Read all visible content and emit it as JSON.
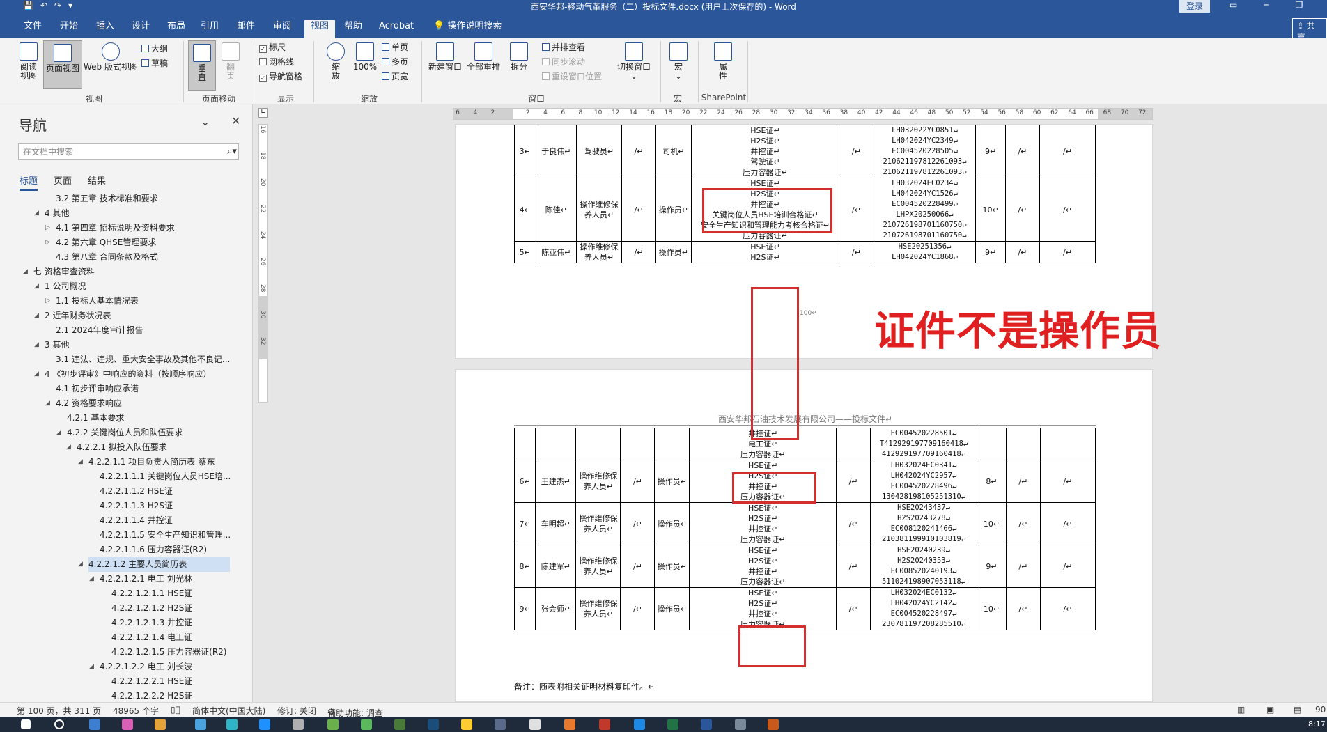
{
  "window": {
    "title": "西安华邦-移动气革服务（二）投标文件.docx (用户上次保存的) - Word",
    "login": "登录",
    "controls": [
      "▭",
      "─",
      "❐",
      "✕"
    ]
  },
  "tabs": [
    "文件",
    "开始",
    "插入",
    "设计",
    "布局",
    "引用",
    "邮件",
    "审阅",
    "视图",
    "帮助",
    "Acrobat",
    "操作说明搜索"
  ],
  "share": "共享",
  "ribbon": {
    "views": {
      "read": "阅读\n视图",
      "print": "页面视图",
      "web": "Web 版式视图",
      "outline": "大纲",
      "draft": "草稿",
      "label": "视图"
    },
    "page_move": {
      "vertical": "垂\n直",
      "side": "翻\n页",
      "label": "页面移动"
    },
    "show": {
      "ruler": "标尺",
      "grid": "网格线",
      "nav": "导航窗格",
      "label": "显示"
    },
    "zoom": {
      "zoom": "缩\n放",
      "hundred": "100%",
      "single": "单页",
      "multi": "多页",
      "width": "页宽",
      "label": "缩放"
    },
    "window": {
      "new": "新建窗口",
      "arrange": "全部重排",
      "split": "拆分",
      "side": "并排查看",
      "sync": "同步滚动",
      "reset": "重设窗口位置",
      "switch": "切换窗口",
      "label": "窗口"
    },
    "macro": {
      "btn": "宏",
      "label": "宏"
    },
    "sharepoint": {
      "btn": "属\n性",
      "label": "SharePoint"
    }
  },
  "nav": {
    "title": "导航",
    "search_placeholder": "在文档中搜索",
    "tabs": [
      "标题",
      "页面",
      "结果"
    ],
    "tree": [
      {
        "t": "3.2 第五章  技术标准和要求",
        "lvl": 2
      },
      {
        "t": "4 其他",
        "lvl": 1,
        "ar": "◢"
      },
      {
        "t": "4.1 第四章  招标说明及资料要求",
        "lvl": 2,
        "ar": "▷"
      },
      {
        "t": "4.2 第六章  QHSE管理要求",
        "lvl": 2,
        "ar": "▷"
      },
      {
        "t": "4.3 第八章  合同条款及格式",
        "lvl": 2
      },
      {
        "t": "七  资格审查资料",
        "lvl": 0,
        "ar": "◢"
      },
      {
        "t": "1 公司概况",
        "lvl": 1,
        "ar": "◢"
      },
      {
        "t": "1.1 投标人基本情况表",
        "lvl": 2,
        "ar": "▷"
      },
      {
        "t": "2 近年财务状况表",
        "lvl": 1,
        "ar": "◢"
      },
      {
        "t": "2.1 2024年度审计报告",
        "lvl": 2
      },
      {
        "t": "3 其他",
        "lvl": 1,
        "ar": "◢"
      },
      {
        "t": "3.1 违法、违规、重大安全事故及其他不良记...",
        "lvl": 2
      },
      {
        "t": "4 《初步评审》中响应的资料（按顺序响应）",
        "lvl": 1,
        "ar": "◢"
      },
      {
        "t": "4.1 初步评审响应承诺",
        "lvl": 2
      },
      {
        "t": "4.2 资格要求响应",
        "lvl": 2,
        "ar": "◢"
      },
      {
        "t": "4.2.1 基本要求",
        "lvl": 3
      },
      {
        "t": "4.2.2 关键岗位人员和队伍要求",
        "lvl": 3,
        "ar": "◢"
      },
      {
        "t": "4.2.2.1 拟投入队伍要求",
        "lvl": 4,
        "ar": "◢"
      },
      {
        "t": "4.2.2.1.1 项目负责人简历表-蔡东",
        "lvl": 5,
        "ar": "◢"
      },
      {
        "t": "4.2.2.1.1.1 关键岗位人员HSE培...",
        "lvl": 6
      },
      {
        "t": "4.2.2.1.1.2 HSE证",
        "lvl": 6
      },
      {
        "t": "4.2.2.1.1.3 H2S证",
        "lvl": 6
      },
      {
        "t": "4.2.2.1.1.4 井控证",
        "lvl": 6
      },
      {
        "t": "4.2.2.1.1.5 安全生产知识和管理...",
        "lvl": 6
      },
      {
        "t": "4.2.2.1.1.6 压力容器证(R2)",
        "lvl": 6
      },
      {
        "t": "4.2.2.1.2 主要人员简历表",
        "lvl": 5,
        "ar": "◢",
        "sel": true
      },
      {
        "t": "4.2.2.1.2.1 电工-刘光林",
        "lvl": 6,
        "ar": "◢"
      },
      {
        "t": "4.2.2.1.2.1.1 HSE证",
        "lvl": 7
      },
      {
        "t": "4.2.2.1.2.1.2 H2S证",
        "lvl": 7
      },
      {
        "t": "4.2.2.1.2.1.3 井控证",
        "lvl": 7
      },
      {
        "t": "4.2.2.1.2.1.4 电工证",
        "lvl": 7
      },
      {
        "t": "4.2.2.1.2.1.5 压力容器证(R2)",
        "lvl": 7
      },
      {
        "t": "4.2.2.1.2.2 电工-刘长波",
        "lvl": 6,
        "ar": "◢"
      },
      {
        "t": "4.2.2.1.2.2.1 HSE证",
        "lvl": 7
      },
      {
        "t": "4.2.2.1.2.2.2 H2S证",
        "lvl": 7
      }
    ]
  },
  "page1": {
    "rows": [
      {
        "no": "3↵",
        "name": "于良伟↵",
        "role": "驾驶员↵",
        "c4": "/↵",
        "post": "司机↵",
        "certs": [
          "HSE证↵",
          "H2S证↵",
          "井控证↵",
          "驾驶证↵",
          "压力容器证↵"
        ],
        "c7": "/↵",
        "nums": [
          "LH032022YC0851↵",
          "LH042024YC2349↵",
          "EC004520228505↵",
          "210621197812261093↵",
          "210621197812261093↵"
        ],
        "yrs": "9↵",
        "c10": "/↵",
        "c11": "/↵"
      },
      {
        "no": "4↵",
        "name": "陈佳↵",
        "role": "操作维修保养人员↵",
        "c4": "/↵",
        "post": "操作员↵",
        "certs": [
          "HSE证↵",
          "H2S证↵",
          "井控证↵",
          "关键岗位人员HSE培训合格证↵",
          "安全生产知识和管理能力考核合格证↵",
          "压力容器证↵"
        ],
        "c7": "/↵",
        "nums": [
          "LH032024EC0234↵",
          "LH042024YC1526↵",
          "EC004520228499↵",
          "LHPX20250066↵",
          "210726198701160750↵",
          "210726198701160750↵"
        ],
        "yrs": "10↵",
        "c10": "/↵",
        "c11": "/↵"
      },
      {
        "no": "5↵",
        "name": "陈亚伟↵",
        "role": "操作维修保养人员↵",
        "c4": "/↵",
        "post": "操作员↵",
        "certs": [
          "HSE证↵",
          "H2S证↵"
        ],
        "c7": "/↵",
        "nums": [
          "HSE20251356↵",
          "LH042024YC1868↵"
        ],
        "yrs": "9↵",
        "c10": "/↵",
        "c11": "/↵"
      }
    ],
    "page_num": "100↵"
  },
  "annotation": "证件不是操作员",
  "page2": {
    "header": "西安华邦石油技术发展有限公司——投标文件↵",
    "cont": {
      "certs": [
        "井控证↵",
        "电工证↵",
        "压力容器证↵"
      ],
      "nums": [
        "EC004520228501↵",
        "T412929197709160418↵",
        "412929197709160418↵"
      ]
    },
    "rows": [
      {
        "no": "6↵",
        "name": "王建杰↵",
        "role": "操作维修保养人员↵",
        "c4": "/↵",
        "post": "操作员↵",
        "certs": [
          "HSE证↵",
          "H2S证↵",
          "井控证↵",
          "压力容器证↵"
        ],
        "c7": "/↵",
        "nums": [
          "LH032024EC0341↵",
          "LH042024YC2957↵",
          "EC004520228496↵",
          "130428198105251310↵"
        ],
        "yrs": "8↵",
        "c10": "/↵",
        "c11": "/↵"
      },
      {
        "no": "7↵",
        "name": "车明超↵",
        "role": "操作维修保养人员↵",
        "c4": "/↵",
        "post": "操作员↵",
        "certs": [
          "HSE证↵",
          "H2S证↵",
          "井控证↵",
          "压力容器证↵"
        ],
        "c7": "/↵",
        "nums": [
          "HSE20243437↵",
          "H2S20243278↵",
          "EC008120241466↵",
          "210381199910103819↵"
        ],
        "yrs": "10↵",
        "c10": "/↵",
        "c11": "/↵"
      },
      {
        "no": "8↵",
        "name": "陈建军↵",
        "role": "操作维修保养人员↵",
        "c4": "/↵",
        "post": "操作员↵",
        "certs": [
          "HSE证↵",
          "H2S证↵",
          "井控证↵",
          "压力容器证↵"
        ],
        "c7": "/↵",
        "nums": [
          "HSE20240239↵",
          "H2S20240353↵",
          "EC008520240193↵",
          "511024198907053118↵"
        ],
        "yrs": "9↵",
        "c10": "/↵",
        "c11": "/↵"
      },
      {
        "no": "9↵",
        "name": "张会师↵",
        "role": "操作维修保养人员↵",
        "c4": "/↵",
        "post": "操作员↵",
        "certs": [
          "HSE证↵",
          "H2S证↵",
          "井控证↵",
          "压力容器证↵"
        ],
        "c7": "/↵",
        "nums": [
          "LH032024EC0132↵",
          "LH042024YC2142↵",
          "EC004520228497↵",
          "230781197208285510↵"
        ],
        "yrs": "10↵",
        "c10": "/↵",
        "c11": "/↵"
      }
    ],
    "note": "备注：随表附相关证明材料复印件。↵"
  },
  "status": {
    "page": "第 100 页，共 311 页",
    "words": "48965 个字",
    "lang": "简体中文(中国大陆)",
    "track": "修订: 关闭",
    "access": "辅助功能: 调查",
    "zoom": "90",
    "time": "8:17"
  },
  "ruler": {
    "h": [
      "6",
      "4",
      "2",
      "",
      "2",
      "4",
      "6",
      "8",
      "10",
      "12",
      "14",
      "16",
      "18",
      "20",
      "22",
      "24",
      "26",
      "28",
      "30",
      "32",
      "34",
      "36",
      "38",
      "40",
      "42",
      "44",
      "46",
      "48",
      "50",
      "52",
      "54",
      "56",
      "58",
      "60",
      "62",
      "64",
      "66",
      "68",
      "70",
      "72"
    ],
    "v": [
      "16",
      "18",
      "20",
      "22",
      "24",
      "26",
      "28",
      "30",
      "32"
    ]
  }
}
